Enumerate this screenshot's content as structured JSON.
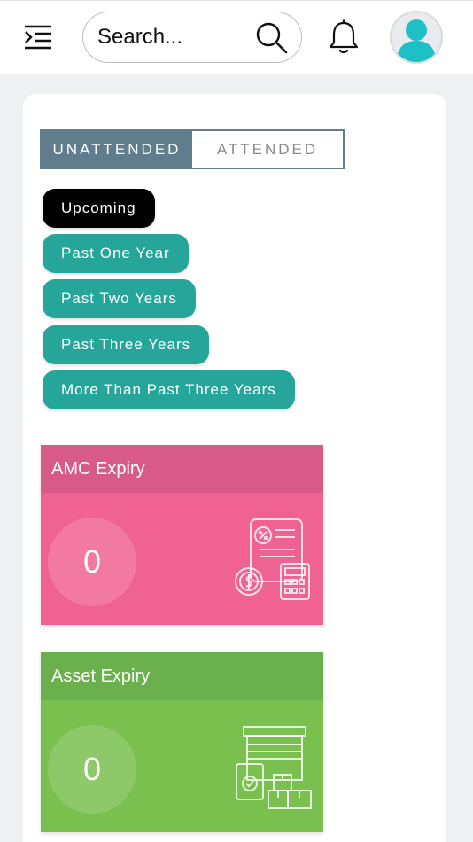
{
  "header": {
    "menu_icon": "menu-collapse-icon",
    "search": {
      "placeholder": "Search...",
      "icon": "search-icon"
    },
    "notification_icon": "bell-icon",
    "avatar_icon": "user-avatar-icon"
  },
  "tabs": [
    {
      "label": "UNATTENDED",
      "active": true
    },
    {
      "label": "ATTENDED",
      "active": false
    }
  ],
  "filters": [
    {
      "label": "Upcoming",
      "selected": true
    },
    {
      "label": "Past One Year",
      "selected": false
    },
    {
      "label": "Past Two Years",
      "selected": false
    },
    {
      "label": "Past Three Years",
      "selected": false
    },
    {
      "label": "More Than Past Three Years",
      "selected": false
    }
  ],
  "stats": [
    {
      "title": "AMC Expiry",
      "count": "0",
      "icon": "invoice-calculator-icon"
    },
    {
      "title": "Asset Expiry",
      "count": "0",
      "icon": "warehouse-boxes-icon"
    }
  ],
  "colors": {
    "tab_active": "#5f7d8c",
    "pill_selected": "#000000",
    "pill_default": "#26a69a",
    "amc_header": "#d85a86",
    "amc_body": "#f06292",
    "asset_header": "#6ab04c",
    "asset_body": "#7ac04f",
    "avatar": "#1ec0c8"
  }
}
